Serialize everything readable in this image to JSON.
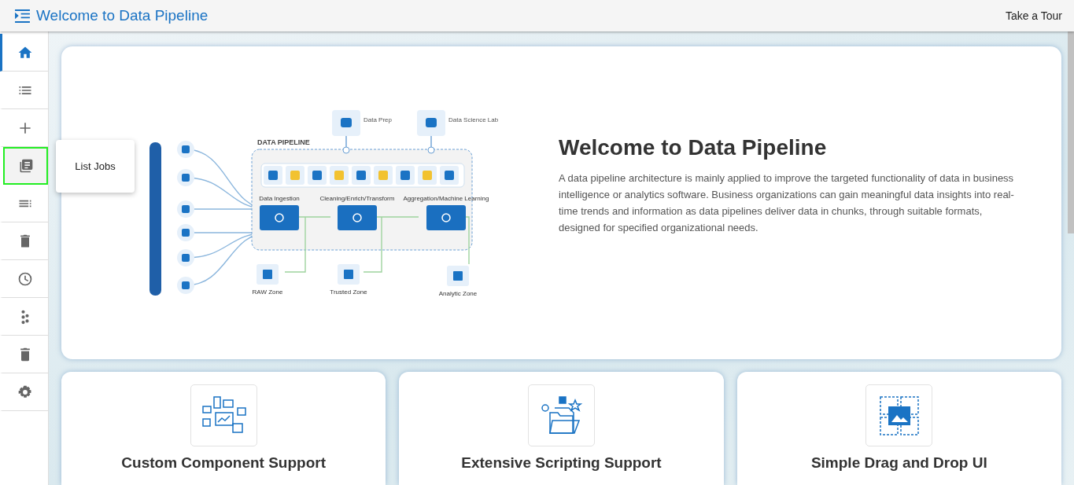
{
  "header": {
    "title": "Welcome to Data Pipeline",
    "tour_link": "Take a Tour"
  },
  "sidebar": {
    "items": [
      {
        "kind": "home",
        "selected": true,
        "hovered": false
      },
      {
        "kind": "list",
        "selected": false,
        "hovered": false
      },
      {
        "kind": "plus",
        "selected": false,
        "hovered": false
      },
      {
        "kind": "jobs",
        "selected": false,
        "hovered": true
      },
      {
        "kind": "queue",
        "selected": false,
        "hovered": false
      },
      {
        "kind": "bin-x",
        "selected": false,
        "hovered": false
      },
      {
        "kind": "clock",
        "selected": false,
        "hovered": false
      },
      {
        "kind": "nodes",
        "selected": false,
        "hovered": false
      },
      {
        "kind": "trash",
        "selected": false,
        "hovered": false
      },
      {
        "kind": "gear",
        "selected": false,
        "hovered": false
      }
    ],
    "tooltip": "List Jobs"
  },
  "hero": {
    "diagram": {
      "heading": "DATA PIPELINE",
      "top_nodes": [
        "Data Prep",
        "Data Science Lab"
      ],
      "stages": [
        "Data Ingestion",
        "Cleaning/Enrich/Transform",
        "Aggregation/Machine Learning"
      ],
      "zones": [
        "RAW Zone",
        "Trusted Zone",
        "Analytic Zone"
      ]
    },
    "title": "Welcome to Data Pipeline",
    "description": "A data pipeline architecture is mainly applied to improve the targeted functionality of data in business intelligence or analytics software. Business organizations can gain meaningful data insights into real-time trends and information as data pipelines deliver data in chunks, through suitable formats, designed for specified organizational needs."
  },
  "features": [
    {
      "kind": "components",
      "title": "Custom Component Support"
    },
    {
      "kind": "scripting",
      "title": "Extensive Scripting Support"
    },
    {
      "kind": "dragdrop",
      "title": "Simple Drag and Drop UI"
    }
  ]
}
